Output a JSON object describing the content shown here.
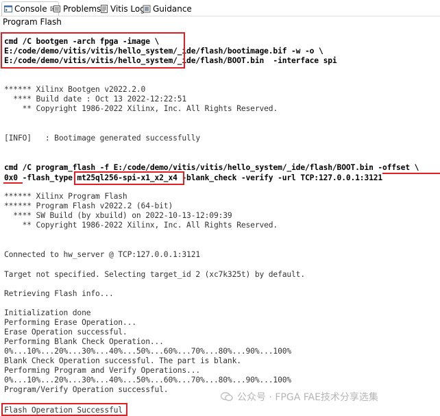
{
  "tabs": [
    {
      "label": "Console",
      "close": "⊠",
      "icon": "console-icon"
    },
    {
      "label": "Problems",
      "icon": "problems-icon"
    },
    {
      "label": "Vitis Log",
      "icon": "vitis-log-icon"
    },
    {
      "label": "Guidance",
      "icon": "guidance-icon"
    }
  ],
  "view_title": "Program Flash",
  "console_lines": [
    "cmd /C bootgen -arch fpga -image \\",
    "E:/code/demo/vitis/vitis/hello_system/_ide/flash/bootimage.bif -w -o \\",
    "E:/code/demo/vitis/vitis/hello_system/_ide/flash/BOOT.bin  -interface spi",
    "****** Xilinx Bootgen v2022.2.0",
    "  **** Build date : Oct 13 2022-12:22:51",
    "    ** Copyright 1986-2022 Xilinx, Inc. All Rights Reserved.",
    "[INFO]   : Bootimage generated successfully",
    "cmd /C program_flash -f E:/code/demo/vitis/vitis/hello_system/_ide/flash/BOOT.bin -offset \\",
    "0x0 -flash_type mt25ql256-spi-x1_x2_x4 -blank_check -verify -url TCP:127.0.0.1:3121",
    "****** Xilinx Program Flash",
    "****** Program Flash v2022.2 (64-bit)",
    "  **** SW Build (by xbuild) on 2022-10-13-12:09:39",
    "    ** Copyright 1986-2022 Xilinx, Inc. All Rights Reserved.",
    "Connected to hw_server @ TCP:127.0.0.1:3121",
    "Target not specified. Selecting target_id 2 (xc7k325t) by default.",
    "Retrieving Flash info...",
    "Initialization done",
    "Performing Erase Operation...",
    "Erase Operation successful.",
    "Performing Blank Check Operation...",
    "0%...10%...20%...30%...40%...50%...60%...70%...80%...90%...100%",
    "Blank Check Operation successful. The part is blank.",
    "Performing Program and Verify Operations...",
    "0%...10%...20%...30%...40%...50%...60%...70%...80%...90%...100%",
    "Program/Verify Operation successful.",
    "Flash Operation Successful"
  ],
  "watermark": "公众号 · FPGA FAE技术分享选集",
  "colors": {
    "highlight": "#e02020",
    "text": "#000000"
  }
}
